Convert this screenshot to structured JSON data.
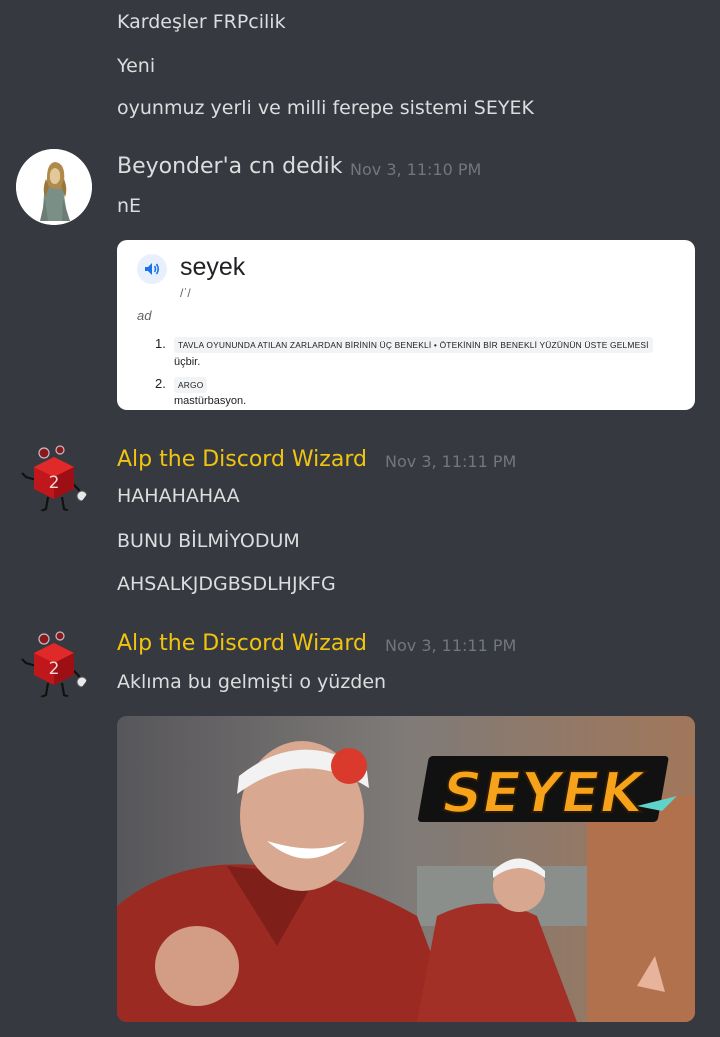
{
  "messages_top": {
    "line1": "Kardeşler FRPcilik",
    "line2": "Yeni",
    "line3": "oyunmuz yerli ve milli ferepe sistemi SEYEK"
  },
  "message_beyonder": {
    "username": "Beyonder'a cn dedik",
    "timestamp": "Nov 3, 11:10 PM",
    "username_color": "#ffffff",
    "text": "nE"
  },
  "dictionary_card": {
    "word": "seyek",
    "phonetic": "/ˈ/",
    "part_of_speech": "ad",
    "senses": [
      {
        "num": "1.",
        "tag": "TAVLA OYUNUNDA ATILAN ZARLARDAN BİRİNİN ÜÇ BENEKLİ • ÖTEKİNİN BİR BENEKLİ YÜZÜNÜN ÜSTE GELMESİ",
        "def": "üçbir."
      },
      {
        "num": "2.",
        "tag": "ARGO",
        "def": "mastürbasyon."
      }
    ],
    "speaker_icon": "speaker-icon"
  },
  "message_alp_1": {
    "username": "Alp the Discord Wizard",
    "timestamp": "Nov 3, 11:11 PM",
    "username_color": "#f1c40f",
    "lines": [
      "HAHAHAHAA",
      "BUNU BİLMİYODUM",
      "AHSALKJDGBSDLHJKFG"
    ]
  },
  "message_alp_2": {
    "username": "Alp the Discord Wizard",
    "timestamp": "Nov 3, 11:11 PM",
    "username_color": "#f1c40f",
    "text": "Aklıma bu gelmişti o yüzden"
  },
  "video_thumbnail": {
    "title_text": "SEYEK"
  },
  "colors": {
    "background": "#36393f",
    "message_text": "#dcddde",
    "timestamp": "#72767d",
    "alp_name": "#f1c40f"
  }
}
